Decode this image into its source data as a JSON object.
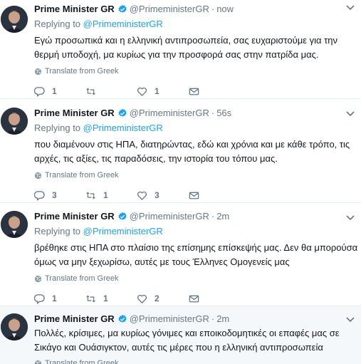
{
  "tweets": [
    {
      "name": "Prime Minister GR",
      "handle": "@PrimeministerGR",
      "dot": "·",
      "time": "now",
      "replying_prefix": "Replying to ",
      "replying_to": "@PrimeministerGR",
      "text": "Εγώ προσωπικά και η ελληνική αντιπροσωπεία, σας ευχαριστούμε για την θερμή υποδοχή, μα κυρίως για την προσφορά σας στην πατρίδα μας.",
      "translate": "Translate from Greek",
      "replies": "1",
      "retweets": "",
      "likes": "1"
    },
    {
      "name": "Prime Minister GR",
      "handle": "@PrimeministerGR",
      "dot": "·",
      "time": "56s",
      "replying_prefix": "Replying to ",
      "replying_to": "@PrimeministerGR",
      "text": "που διαμένουν στις ΗΠΑ, διατηρώντας, εδώ και χρόνια και με κάθε τρόπο, τις αρχές, τις αξίες, τις παραδόσεις, την ιστορία του τόπου μας.",
      "translate": "Translate from Greek",
      "replies": "3",
      "retweets": "1",
      "likes": "3"
    },
    {
      "name": "Prime Minister GR",
      "handle": "@PrimeministerGR",
      "dot": "·",
      "time": "2m",
      "replying_prefix": "Replying to ",
      "replying_to": "@PrimeministerGR",
      "text": "βρέθηκε στις ΗΠΑ στο πλαίσιο της επίσημης επίσκεψής μας. Δεν θα μπορούσα όμως να μην ξεχωρίσω, αυτές με τους Έλληνες Ομογενείς μας",
      "translate": "Translate from Greek",
      "replies": "1",
      "retweets": "1",
      "likes": "2"
    },
    {
      "name": "Prime Minister GR",
      "handle": "@PrimeministerGR",
      "dot": "·",
      "time": "2m",
      "text": "Πολλές, κρίσιμες, μα κυρίως γόνιμες και εποικοδομητικές οι επαφές μας σε Σικάγο και Ουάσιγκτον, αυτές τις μέρες που η ελληνική αντιπροσωπεία",
      "translate": "Translate from Greek"
    }
  ],
  "colors": {
    "accent": "#1da1f2",
    "muted": "#657786",
    "text": "#14171a",
    "divider": "#e6ecf0",
    "highlight_bg": "#f5f8fa"
  },
  "icons": [
    "verified-badge-icon",
    "caret-down-icon",
    "globe-icon",
    "reply-icon",
    "retweet-icon",
    "like-icon",
    "direct-message-icon"
  ]
}
